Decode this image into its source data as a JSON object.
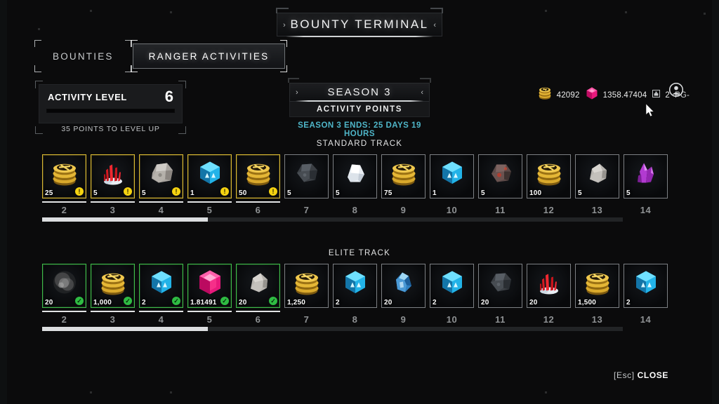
{
  "window": {
    "title": "BOUNTY TERMINAL",
    "left_chevron": "›",
    "right_chevron": "‹"
  },
  "tabs": [
    {
      "label": "BOUNTIES",
      "active": false
    },
    {
      "label": "RANGER ACTIVITIES",
      "active": true
    }
  ],
  "activity_level": {
    "label": "ACTIVITY LEVEL",
    "value": "6",
    "progress_percent": 0,
    "subtext": "35 POINTS TO LEVEL UP"
  },
  "season": {
    "name": "SEASON 3",
    "subtitle": "ACTIVITY POINTS",
    "ends_text": "SEASON 3 ENDS:  25 DAYS  19 HOURS",
    "ends_color": "#4fb6c9",
    "left_chevron": "›",
    "right_chevron": "‹"
  },
  "currency": [
    {
      "icon": "gold-coins-icon",
      "value": "42092"
    },
    {
      "icon": "pink-gem-icon",
      "value": "1358.47404"
    },
    {
      "icon": "salvage-icon",
      "value": "2"
    },
    {
      "icon": "text-label",
      "value": "PG-"
    }
  ],
  "profile": {
    "icon": "account-avatar-icon"
  },
  "tracks": [
    {
      "name": "STANDARD TRACK",
      "progress_percent": 28.5,
      "tiers": [
        "2",
        "3",
        "4",
        "5",
        "6",
        "7",
        "8",
        "9",
        "10",
        "11",
        "12",
        "13",
        "14"
      ],
      "completed_tiers": 5,
      "rewards": [
        {
          "icon": "gold-coins-icon",
          "qty": "25",
          "state": "claimable"
        },
        {
          "icon": "red-coral-icon",
          "qty": "5",
          "state": "claimable"
        },
        {
          "icon": "gray-ore-icon",
          "qty": "5",
          "state": "claimable"
        },
        {
          "icon": "blue-cube-icon",
          "qty": "1",
          "state": "claimable"
        },
        {
          "icon": "gold-coins-icon",
          "qty": "50",
          "state": "claimable"
        },
        {
          "icon": "dark-ore-icon",
          "qty": "5",
          "state": "locked"
        },
        {
          "icon": "white-crystal-icon",
          "qty": "5",
          "state": "locked"
        },
        {
          "icon": "gold-coins-icon",
          "qty": "75",
          "state": "locked"
        },
        {
          "icon": "blue-cube-icon",
          "qty": "1",
          "state": "locked"
        },
        {
          "icon": "red-ore-icon",
          "qty": "5",
          "state": "locked"
        },
        {
          "icon": "gold-coins-icon",
          "qty": "100",
          "state": "locked"
        },
        {
          "icon": "gray-rock-icon",
          "qty": "5",
          "state": "locked"
        },
        {
          "icon": "purple-crystal-icon",
          "qty": "5",
          "state": "locked"
        }
      ]
    },
    {
      "name": "ELITE TRACK",
      "progress_percent": 28.5,
      "tiers": [
        "2",
        "3",
        "4",
        "5",
        "6",
        "7",
        "8",
        "9",
        "10",
        "11",
        "12",
        "13",
        "14"
      ],
      "completed_tiers": 5,
      "rewards": [
        {
          "icon": "gray-dust-icon",
          "qty": "20",
          "state": "claimed"
        },
        {
          "icon": "gold-coins-icon",
          "qty": "1,000",
          "state": "claimed"
        },
        {
          "icon": "blue-cube-icon",
          "qty": "2",
          "state": "claimed"
        },
        {
          "icon": "pink-gem-icon",
          "qty": "1.81491",
          "state": "claimed"
        },
        {
          "icon": "gray-rock-icon",
          "qty": "20",
          "state": "claimed"
        },
        {
          "icon": "gold-coins-icon",
          "qty": "1,250",
          "state": "locked"
        },
        {
          "icon": "blue-cube-icon",
          "qty": "2",
          "state": "locked"
        },
        {
          "icon": "blue-crystal-icon",
          "qty": "20",
          "state": "locked"
        },
        {
          "icon": "blue-cube-icon",
          "qty": "2",
          "state": "locked"
        },
        {
          "icon": "dark-ore-icon",
          "qty": "20",
          "state": "locked"
        },
        {
          "icon": "red-coral-icon",
          "qty": "20",
          "state": "locked"
        },
        {
          "icon": "gold-coins-icon",
          "qty": "1,500",
          "state": "locked"
        },
        {
          "icon": "blue-cube-icon",
          "qty": "2",
          "state": "locked"
        }
      ]
    }
  ],
  "footer": {
    "key": "[Esc]",
    "action": "CLOSE"
  }
}
